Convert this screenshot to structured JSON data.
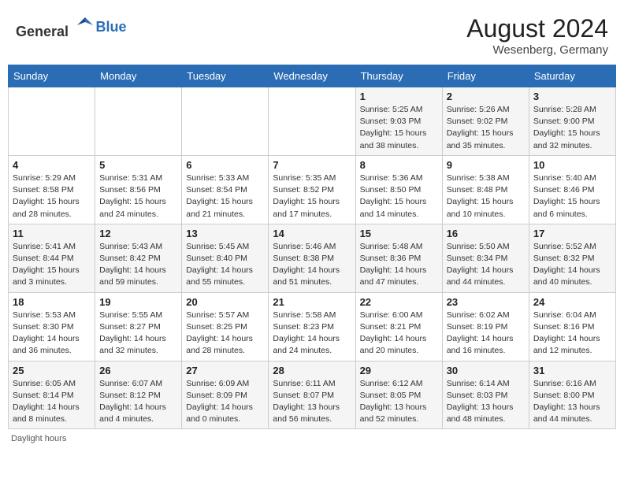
{
  "header": {
    "logo_general": "General",
    "logo_blue": "Blue",
    "month_year": "August 2024",
    "location": "Wesenberg, Germany"
  },
  "days_of_week": [
    "Sunday",
    "Monday",
    "Tuesday",
    "Wednesday",
    "Thursday",
    "Friday",
    "Saturday"
  ],
  "footer": {
    "note": "Daylight hours"
  },
  "weeks": [
    {
      "days": [
        {
          "number": "",
          "info": ""
        },
        {
          "number": "",
          "info": ""
        },
        {
          "number": "",
          "info": ""
        },
        {
          "number": "",
          "info": ""
        },
        {
          "number": "1",
          "info": "Sunrise: 5:25 AM\nSunset: 9:03 PM\nDaylight: 15 hours\nand 38 minutes."
        },
        {
          "number": "2",
          "info": "Sunrise: 5:26 AM\nSunset: 9:02 PM\nDaylight: 15 hours\nand 35 minutes."
        },
        {
          "number": "3",
          "info": "Sunrise: 5:28 AM\nSunset: 9:00 PM\nDaylight: 15 hours\nand 32 minutes."
        }
      ]
    },
    {
      "days": [
        {
          "number": "4",
          "info": "Sunrise: 5:29 AM\nSunset: 8:58 PM\nDaylight: 15 hours\nand 28 minutes."
        },
        {
          "number": "5",
          "info": "Sunrise: 5:31 AM\nSunset: 8:56 PM\nDaylight: 15 hours\nand 24 minutes."
        },
        {
          "number": "6",
          "info": "Sunrise: 5:33 AM\nSunset: 8:54 PM\nDaylight: 15 hours\nand 21 minutes."
        },
        {
          "number": "7",
          "info": "Sunrise: 5:35 AM\nSunset: 8:52 PM\nDaylight: 15 hours\nand 17 minutes."
        },
        {
          "number": "8",
          "info": "Sunrise: 5:36 AM\nSunset: 8:50 PM\nDaylight: 15 hours\nand 14 minutes."
        },
        {
          "number": "9",
          "info": "Sunrise: 5:38 AM\nSunset: 8:48 PM\nDaylight: 15 hours\nand 10 minutes."
        },
        {
          "number": "10",
          "info": "Sunrise: 5:40 AM\nSunset: 8:46 PM\nDaylight: 15 hours\nand 6 minutes."
        }
      ]
    },
    {
      "days": [
        {
          "number": "11",
          "info": "Sunrise: 5:41 AM\nSunset: 8:44 PM\nDaylight: 15 hours\nand 3 minutes."
        },
        {
          "number": "12",
          "info": "Sunrise: 5:43 AM\nSunset: 8:42 PM\nDaylight: 14 hours\nand 59 minutes."
        },
        {
          "number": "13",
          "info": "Sunrise: 5:45 AM\nSunset: 8:40 PM\nDaylight: 14 hours\nand 55 minutes."
        },
        {
          "number": "14",
          "info": "Sunrise: 5:46 AM\nSunset: 8:38 PM\nDaylight: 14 hours\nand 51 minutes."
        },
        {
          "number": "15",
          "info": "Sunrise: 5:48 AM\nSunset: 8:36 PM\nDaylight: 14 hours\nand 47 minutes."
        },
        {
          "number": "16",
          "info": "Sunrise: 5:50 AM\nSunset: 8:34 PM\nDaylight: 14 hours\nand 44 minutes."
        },
        {
          "number": "17",
          "info": "Sunrise: 5:52 AM\nSunset: 8:32 PM\nDaylight: 14 hours\nand 40 minutes."
        }
      ]
    },
    {
      "days": [
        {
          "number": "18",
          "info": "Sunrise: 5:53 AM\nSunset: 8:30 PM\nDaylight: 14 hours\nand 36 minutes."
        },
        {
          "number": "19",
          "info": "Sunrise: 5:55 AM\nSunset: 8:27 PM\nDaylight: 14 hours\nand 32 minutes."
        },
        {
          "number": "20",
          "info": "Sunrise: 5:57 AM\nSunset: 8:25 PM\nDaylight: 14 hours\nand 28 minutes."
        },
        {
          "number": "21",
          "info": "Sunrise: 5:58 AM\nSunset: 8:23 PM\nDaylight: 14 hours\nand 24 minutes."
        },
        {
          "number": "22",
          "info": "Sunrise: 6:00 AM\nSunset: 8:21 PM\nDaylight: 14 hours\nand 20 minutes."
        },
        {
          "number": "23",
          "info": "Sunrise: 6:02 AM\nSunset: 8:19 PM\nDaylight: 14 hours\nand 16 minutes."
        },
        {
          "number": "24",
          "info": "Sunrise: 6:04 AM\nSunset: 8:16 PM\nDaylight: 14 hours\nand 12 minutes."
        }
      ]
    },
    {
      "days": [
        {
          "number": "25",
          "info": "Sunrise: 6:05 AM\nSunset: 8:14 PM\nDaylight: 14 hours\nand 8 minutes."
        },
        {
          "number": "26",
          "info": "Sunrise: 6:07 AM\nSunset: 8:12 PM\nDaylight: 14 hours\nand 4 minutes."
        },
        {
          "number": "27",
          "info": "Sunrise: 6:09 AM\nSunset: 8:09 PM\nDaylight: 14 hours\nand 0 minutes."
        },
        {
          "number": "28",
          "info": "Sunrise: 6:11 AM\nSunset: 8:07 PM\nDaylight: 13 hours\nand 56 minutes."
        },
        {
          "number": "29",
          "info": "Sunrise: 6:12 AM\nSunset: 8:05 PM\nDaylight: 13 hours\nand 52 minutes."
        },
        {
          "number": "30",
          "info": "Sunrise: 6:14 AM\nSunset: 8:03 PM\nDaylight: 13 hours\nand 48 minutes."
        },
        {
          "number": "31",
          "info": "Sunrise: 6:16 AM\nSunset: 8:00 PM\nDaylight: 13 hours\nand 44 minutes."
        }
      ]
    }
  ]
}
